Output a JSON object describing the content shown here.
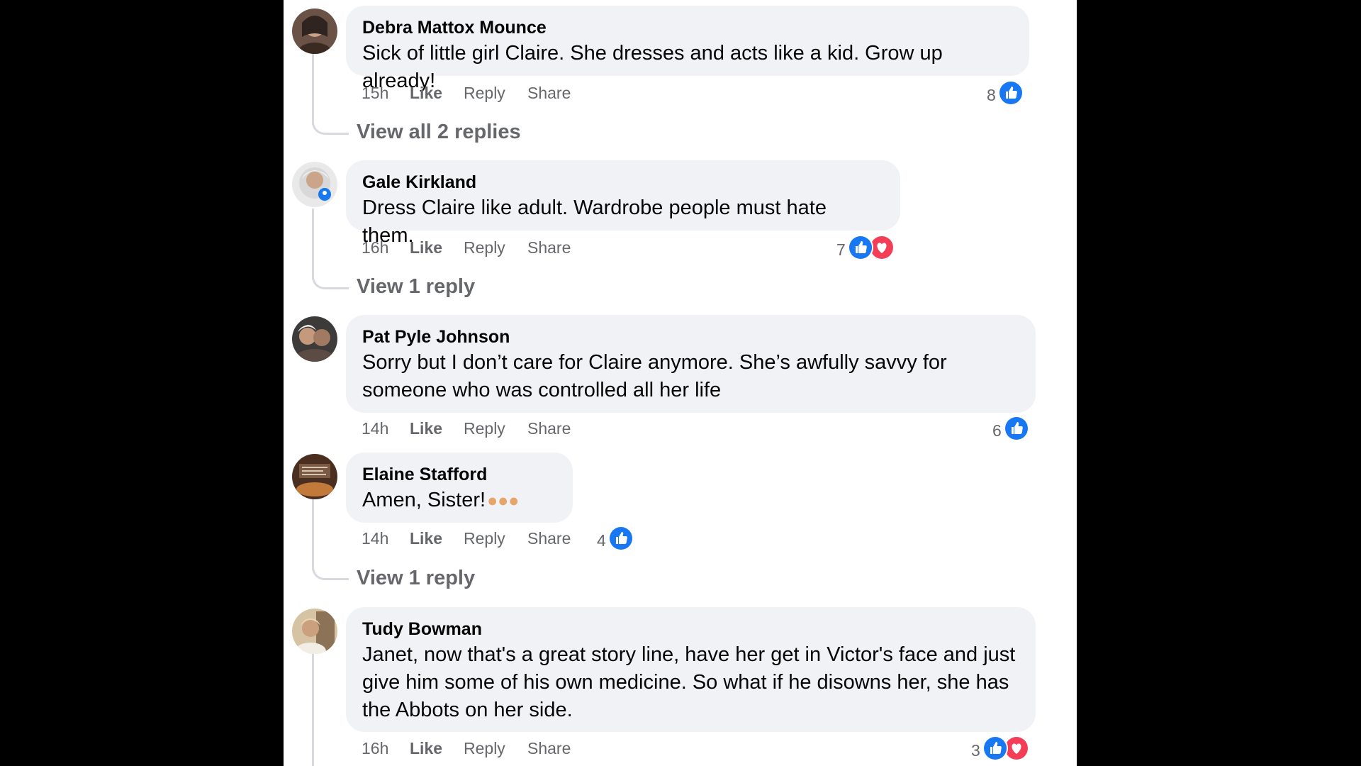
{
  "comments": [
    {
      "author": "Debra Mattox Mounce",
      "text": "Sick of little girl Claire. She dresses and acts like a kid. Grow up already!",
      "time": "15h",
      "like": "Like",
      "reply": "Reply",
      "share": "Share",
      "reaction_count": "8",
      "reactions": [
        "like-icon"
      ],
      "view_replies": "View all 2 replies"
    },
    {
      "author": "Gale Kirkland",
      "text": "Dress Claire like adult. Wardrobe people must hate them.",
      "time": "16h",
      "like": "Like",
      "reply": "Reply",
      "share": "Share",
      "reaction_count": "7",
      "reactions": [
        "like-icon",
        "love-icon"
      ],
      "view_replies": "View 1 reply"
    },
    {
      "author": "Pat Pyle Johnson",
      "text_line1": "Sorry but I don’t care for Claire anymore. She’s awfully savvy for",
      "text_line2": "someone who was controlled all her life",
      "time": "14h",
      "like": "Like",
      "reply": "Reply",
      "share": "Share",
      "reaction_count": "6",
      "reactions": [
        "like-icon"
      ]
    },
    {
      "author": "Elaine Stafford",
      "text": "Amen, Sister!",
      "emoji": "clapping-hands-icon",
      "time": "14h",
      "like": "Like",
      "reply": "Reply",
      "share": "Share",
      "reaction_count": "4",
      "reactions": [
        "like-icon"
      ],
      "view_replies": "View 1 reply"
    },
    {
      "author": "Tudy Bowman",
      "text_line1": "Janet, now that's a great story line, have her get in Victor's face and just",
      "text_line2": "give him some of his own medicine. So what if he disowns her, she has",
      "text_line3": "the Abbots on her side.",
      "time": "16h",
      "like": "Like",
      "reply": "Reply",
      "share": "Share",
      "reaction_count": "3",
      "reactions": [
        "like-icon",
        "love-icon"
      ]
    }
  ],
  "colors": {
    "like_blue": "#1877f2",
    "love_red": "#f33e58",
    "bubble_bg": "#f0f2f5",
    "meta_gray": "#65676b"
  }
}
